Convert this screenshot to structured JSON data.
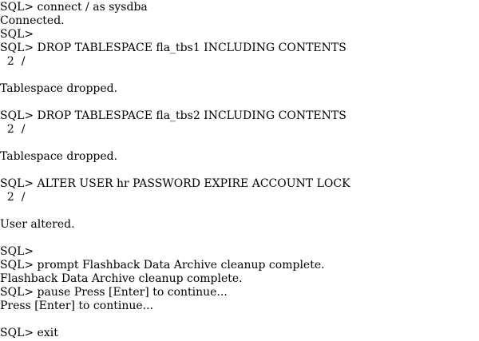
{
  "terminal": {
    "lines": [
      "SQL> connect / as sysdba",
      "Connected.",
      "SQL>",
      "SQL> DROP TABLESPACE fla_tbs1 INCLUDING CONTENTS",
      "  2  /",
      "",
      "Tablespace dropped.",
      "",
      "SQL> DROP TABLESPACE fla_tbs2 INCLUDING CONTENTS",
      "  2  /",
      "",
      "Tablespace dropped.",
      "",
      "SQL> ALTER USER hr PASSWORD EXPIRE ACCOUNT LOCK",
      "  2  /",
      "",
      "User altered.",
      "",
      "SQL>",
      "SQL> prompt Flashback Data Archive cleanup complete.",
      "Flashback Data Archive cleanup complete.",
      "SQL> pause Press [Enter] to continue...",
      "Press [Enter] to continue...",
      "",
      "SQL> exit"
    ]
  }
}
